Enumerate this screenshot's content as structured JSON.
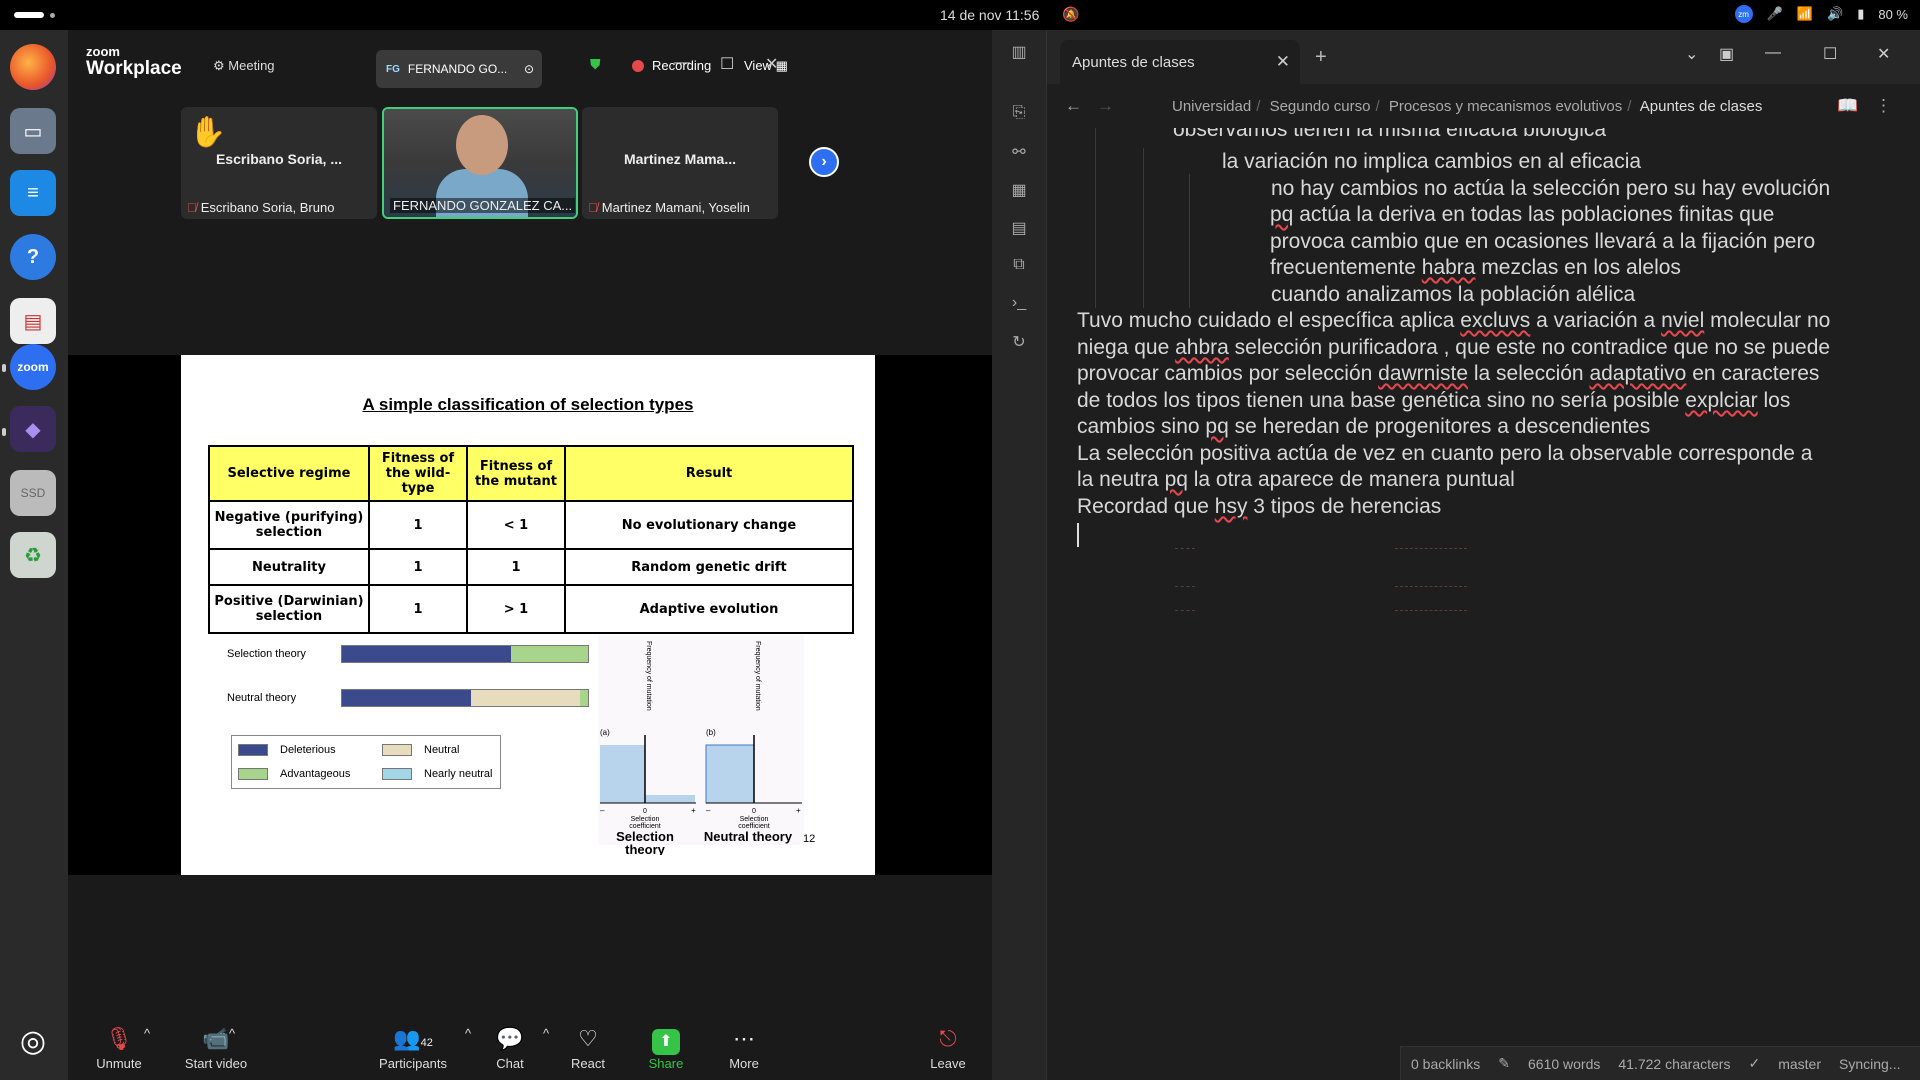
{
  "topbar": {
    "clock": "14 de nov  11:56",
    "battery": "80 %",
    "zoom_tray_label": "zm"
  },
  "dock": {
    "apps": [
      {
        "name": "firefox",
        "icon": "firefox-icon"
      },
      {
        "name": "files",
        "icon": "folder-icon"
      },
      {
        "name": "writer",
        "icon": "document-icon"
      },
      {
        "name": "help",
        "icon": "help-icon"
      },
      {
        "name": "reader",
        "icon": "reader-icon"
      },
      {
        "name": "zoom",
        "icon": "zoom-icon",
        "label": "zoom"
      },
      {
        "name": "obsidian",
        "icon": "obsidian-icon"
      },
      {
        "name": "ssd",
        "icon": "drive-icon",
        "label": "SSD"
      },
      {
        "name": "trash",
        "icon": "trash-icon"
      },
      {
        "name": "ubuntu",
        "icon": "ubuntu-icon"
      }
    ]
  },
  "zoom": {
    "logo_top": "zoom",
    "logo_bottom": "Workplace",
    "meeting_label": "Meeting",
    "speaker_initials": "FG",
    "speaker_name": "FERNANDO GO...",
    "recording_label": "Recording",
    "view_label": "View",
    "participants": [
      {
        "big": "Escribano Soria, ...",
        "label": "Escribano Soria, Bruno"
      },
      {
        "big": "",
        "label": "FERNANDO GONZALEZ CA..."
      },
      {
        "big": "Martinez Mama...",
        "label": "Martinez Mamani, Yoselin"
      }
    ],
    "toolbar": {
      "unmute": "Unmute",
      "start_video": "Start video",
      "participants": "Participants",
      "participants_count": "42",
      "chat": "Chat",
      "react": "React",
      "share": "Share",
      "more": "More",
      "leave": "Leave"
    }
  },
  "slide": {
    "title": "A simple classification of selection types",
    "table": {
      "headers": [
        "Selective regime",
        "Fitness of the wild-type",
        "Fitness of the mutant",
        "Result"
      ],
      "rows": [
        [
          "Negative (purifying) selection",
          "1",
          "< 1",
          "No evolutionary change"
        ],
        [
          "Neutrality",
          "1",
          "1",
          "Random genetic drift"
        ],
        [
          "Positive (Darwinian) selection",
          "1",
          "> 1",
          "Adaptive evolution"
        ]
      ]
    },
    "bars": {
      "selection_label": "Selection theory",
      "neutral_label": "Neutral theory"
    },
    "legend": {
      "deleterious": "Deleterious",
      "neutral": "Neutral",
      "advantageous": "Advantageous",
      "nearly_neutral": "Nearly neutral"
    },
    "hist": {
      "y_label": "Frequency of mutation",
      "a": "(a)",
      "b": "(b)",
      "minus": "–",
      "zero": "0",
      "plus": "+",
      "x_label_line1": "Selection",
      "x_label_line2": "coefficient",
      "caption_a_line1": "Selection",
      "caption_a_line2": "theory",
      "caption_b": "Neutral theory"
    },
    "page_number": "12"
  },
  "obsidian": {
    "tab_title": "Apuntes de clases",
    "breadcrumb": [
      "Universidad",
      "Segundo curso",
      "Procesos y mecanismos evolutivos",
      "Apuntes de clases"
    ],
    "lines": {
      "l0": "observamos tienen la misma eficacia biologica",
      "l1": "la variación no implica cambios en al eficacia",
      "l2": "no hay cambios no actúa la selección pero su hay evolución",
      "l3a": "pq",
      "l3b": " actúa la deriva en todas las poblaciones finitas que",
      "l4": "provoca cambio que en ocasiones llevará a la fijación pero",
      "l5a": "frecuentemente  ",
      "l5b": "habra",
      "l5c": " mezclas en los alelos",
      "l6": "cuando analizamos la población alélica",
      "p1a": "Tuvo mucho cuidado el específica aplica ",
      "p1b": "excluvs",
      "p1c": " a variación a ",
      "p1d": "nviel",
      "p1e": " molecular no",
      "p2a": "niega que ",
      "p2b": "ahbra",
      "p2c": " selección purificadora , que este no contradice que no se puede",
      "p3a": "provocar cambios por selección ",
      "p3b": "dawrniste",
      "p3c": " la selección ",
      "p3d": "adaptativo",
      "p3e": " en caracteres",
      "p4a": "de todos los tipos tienen una base genética sino  no sería posible ",
      "p4b": "explciar",
      "p4c": " los",
      "p5a": "cambios sino ",
      "p5b": "pq",
      "p5c": " se heredan de progenitores a descendientes",
      "p6": "La selección positiva actúa de vez en cuanto pero la observable corresponde a",
      "p7a": "la  neutra ",
      "p7b": "pq",
      "p7c": "  la otra  aparece de manera puntual",
      "p8a": "Recordad que ",
      "p8b": "hsy",
      "p8c": " 3 tipos de  herencias"
    },
    "status": {
      "backlinks": "0 backlinks",
      "words": "6610 words",
      "chars": "41.722 characters",
      "branch": "master",
      "sync": "Syncing..."
    }
  }
}
